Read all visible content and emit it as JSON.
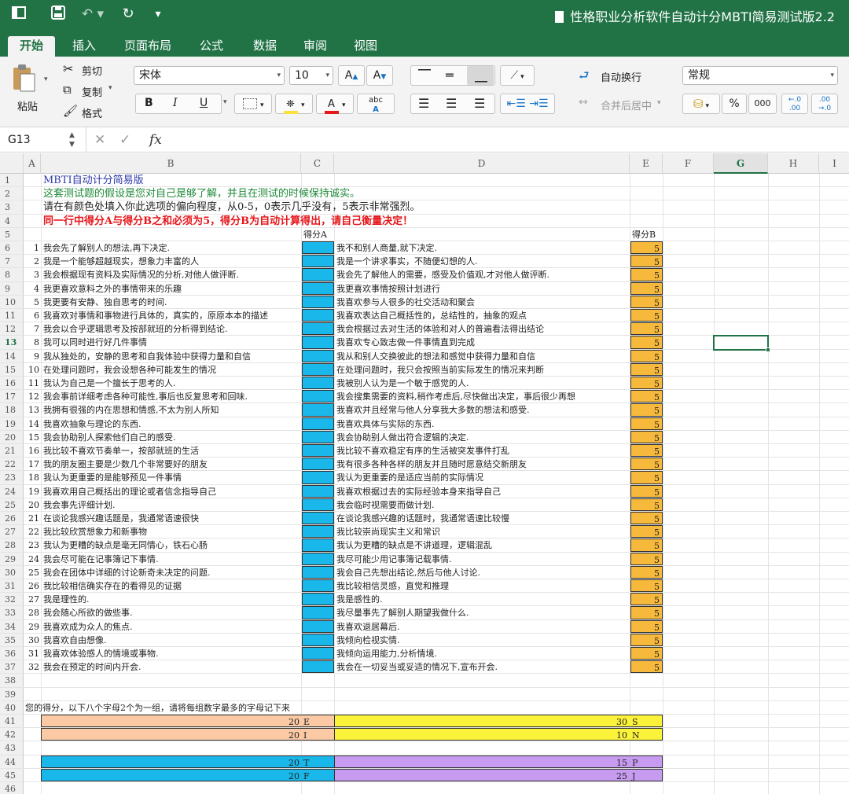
{
  "window": {
    "title": "性格职业分析软件自动计分MBTI简易测试版2.2"
  },
  "tabs": [
    "开始",
    "插入",
    "页面布局",
    "公式",
    "数据",
    "审阅",
    "视图"
  ],
  "ribbon": {
    "paste": "粘贴",
    "cut": "剪切",
    "copy": "复制",
    "format": "格式",
    "font": "宋体",
    "size": "10",
    "wrap": "自动换行",
    "merge": "合并后居中",
    "numfmt": "常规",
    "percent": "%",
    "thousands": "000",
    "bold": "B",
    "italic": "I",
    "underline": "U",
    "abc": "abc"
  },
  "formula_bar": {
    "name_box": "G13",
    "fx": "fx"
  },
  "columns": [
    "A",
    "B",
    "C",
    "D",
    "E",
    "F",
    "G",
    "H",
    "I"
  ],
  "selected_cell": "G13",
  "sheet": {
    "r1": "MBTI自动计分简易版",
    "r2": "这套测试题的假设是您对自己是够了解，并且在测试的时候保持诚实。",
    "r3": "请在有颜色处填入你此选项的偏向程度，从0-5，0表示几乎没有，5表示非常强烈。",
    "r4": "同一行中得分A与得分B之和必须为5，得分B为自动计算得出，请自己衡量决定！",
    "hdrA": "得分A",
    "hdrB": "得分B",
    "r40": "您的得分，以下八个字母2个为一组，请将每组数字最多的字母记下来",
    "colors": {
      "blue": "#1ab7ea",
      "orange": "#f6b93b",
      "peach": "#fbc9a4",
      "yellow": "#fbf23a",
      "purple": "#c79bf0",
      "green": "#217346",
      "blue_text": "#2f3aa8",
      "green_text": "#1f8a3a",
      "red_text": "#e6161b"
    },
    "questions": [
      {
        "n": "1",
        "a": "我会先了解别人的想法,再下决定.",
        "b": "我不和别人商量,就下决定.",
        "score_b": "5"
      },
      {
        "n": "2",
        "a": "我是一个能够超越现实，想象力丰富的人",
        "b": "我是一个讲求事实，不随便幻想的人.",
        "score_b": "5"
      },
      {
        "n": "3",
        "a": "我会根据现有资料及实际情况的分析,对他人做评断.",
        "b": "我会先了解他人的需要，感受及价值观,才对他人做评断.",
        "score_b": "5"
      },
      {
        "n": "4",
        "a": "我更喜欢意料之外的事情带来的乐趣",
        "b": "我更喜欢事情按照计划进行",
        "score_b": "5"
      },
      {
        "n": "5",
        "a": "我更要有安静、独自思考的时间.",
        "b": "我喜欢参与人很多的社交活动和聚会",
        "score_b": "5"
      },
      {
        "n": "6",
        "a": "我喜欢对事情和事物进行具体的，真实的，原原本本的描述",
        "b": "我喜欢表达自己概括性的，总结性的，抽象的观点",
        "score_b": "5"
      },
      {
        "n": "7",
        "a": "我会以合乎逻辑思考及按部就班的分析得到结论.",
        "b": "我会根据过去对生活的体验和对人的普遍看法得出结论",
        "score_b": "5"
      },
      {
        "n": "8",
        "a": "我可以同时进行好几件事情",
        "b": "我喜欢专心致志做一件事情直到完成",
        "score_b": "5"
      },
      {
        "n": "9",
        "a": "我从独处的，安静的思考和自我体验中获得力量和自信",
        "b": "我从和别人交换彼此的想法和感觉中获得力量和自信",
        "score_b": "5"
      },
      {
        "n": "10",
        "a": "在处理问题时，我会设想各种可能发生的情况",
        "b": "在处理问题时，我只会按照当前实际发生的情况来判断",
        "score_b": "5"
      },
      {
        "n": "11",
        "a": "我认为自己是一个擅长于思考的人.",
        "b": "我被别人认为是一个敏于感觉的人.",
        "score_b": "5"
      },
      {
        "n": "12",
        "a": "我会事前详细考虑各种可能性,事后也反复思考和回味.",
        "b": "我会搜集需要的资料,稍作考虑后,尽快做出决定，事后很少再想",
        "score_b": "5"
      },
      {
        "n": "13",
        "a": "我拥有很强的内在思想和情感,不太为别人所知",
        "b": "我喜欢并且经常与他人分享我大多数的想法和感受.",
        "score_b": "5"
      },
      {
        "n": "14",
        "a": "我喜欢抽象与理论的东西.",
        "b": "我喜欢具体与实际的东西.",
        "score_b": "5"
      },
      {
        "n": "15",
        "a": "我会协助别人探索他们自己的感受.",
        "b": "我会协助别人做出符合逻辑的决定.",
        "score_b": "5"
      },
      {
        "n": "16",
        "a": "我比较不喜欢节奏单一，按部就班的生活",
        "b": "我比较不喜欢稳定有序的生活被突发事件打乱",
        "score_b": "5"
      },
      {
        "n": "17",
        "a": "我的朋友圈主要是少数几个非常要好的朋友",
        "b": "我有很多各种各样的朋友并且随时愿意结交新朋友",
        "score_b": "5"
      },
      {
        "n": "18",
        "a": "我认为更重要的是能够预见一件事情",
        "b": "我认为更重要的是适应当前的实际情况",
        "score_b": "5"
      },
      {
        "n": "19",
        "a": "我喜欢用自己概括出的理论或者信念指导自己",
        "b": "我喜欢根据过去的实际经验本身来指导自己",
        "score_b": "5"
      },
      {
        "n": "20",
        "a": "我会事先评细计划.",
        "b": "我会临时视需要而做计划.",
        "score_b": "5"
      },
      {
        "n": "21",
        "a": "在谈论我感兴趣话题是，我通常语速很快",
        "b": "在谈论我感兴趣的话题时，我通常语速比较慢",
        "score_b": "5"
      },
      {
        "n": "22",
        "a": "我比较欣赏想象力和新事物",
        "b": "我比较崇尚现实主义和常识",
        "score_b": "5"
      },
      {
        "n": "23",
        "a": "我认为更糟的缺点是毫无同情心，铁石心肠",
        "b": "我认为更糟的缺点是不讲道理，逻辑混乱",
        "score_b": "5"
      },
      {
        "n": "24",
        "a": "我会尽可能在记事簿记下事情.",
        "b": "我尽可能少用记事簿记载事情.",
        "score_b": "5"
      },
      {
        "n": "25",
        "a": "我会在团体中详细的讨论新奇未决定的问题.",
        "b": "我会自己先想出结论,然后与他人讨论.",
        "score_b": "5"
      },
      {
        "n": "26",
        "a": "我比较相信确实存在的看得见的证据",
        "b": "我比较相信灵感，直觉和推理",
        "score_b": "5"
      },
      {
        "n": "27",
        "a": "我是理性的.",
        "b": "我是感性的.",
        "score_b": "5"
      },
      {
        "n": "28",
        "a": "我会随心所欲的做些事.",
        "b": "我尽量事先了解别人期望我做什么.",
        "score_b": "5"
      },
      {
        "n": "29",
        "a": "我喜欢成为众人的焦点.",
        "b": "我喜欢退居幕后.",
        "score_b": "5"
      },
      {
        "n": "30",
        "a": "我喜欢自由想像.",
        "b": "我倾向检视实情.",
        "score_b": "5"
      },
      {
        "n": "31",
        "a": "我喜欢体验感人的情境或事物.",
        "b": "我倾向运用能力,分析情境.",
        "score_b": "5"
      },
      {
        "n": "32",
        "a": "我会在预定的时间内开会.",
        "b": "我会在一切妥当或妥适的情况下,宣布开会.",
        "score_b": "5"
      }
    ],
    "results": [
      {
        "row": "41",
        "left_val": "20",
        "left_letter": "E",
        "right_val": "30",
        "right_letter": "S",
        "lcolor": "peach",
        "rcolor": "yellow"
      },
      {
        "row": "42",
        "left_val": "20",
        "left_letter": "I",
        "right_val": "10",
        "right_letter": "N",
        "lcolor": "peach",
        "rcolor": "yellow"
      },
      {
        "row": "44",
        "left_val": "20",
        "left_letter": "T",
        "right_val": "15",
        "right_letter": "P",
        "lcolor": "blue",
        "rcolor": "purple"
      },
      {
        "row": "45",
        "left_val": "20",
        "left_letter": "F",
        "right_val": "25",
        "right_letter": "J",
        "lcolor": "blue",
        "rcolor": "purple"
      }
    ]
  }
}
